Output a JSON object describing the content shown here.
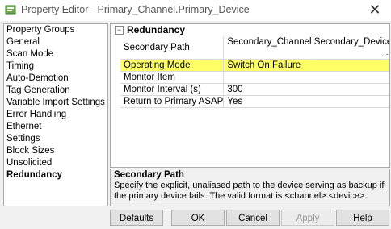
{
  "window": {
    "title": "Property Editor - Primary_Channel.Primary_Device",
    "icons": {
      "app": "properties-icon",
      "close": "close-icon"
    }
  },
  "sidebar": {
    "items": [
      {
        "label": "Property Groups",
        "active": false
      },
      {
        "label": "General",
        "active": false
      },
      {
        "label": "Scan Mode",
        "active": false
      },
      {
        "label": "Timing",
        "active": false
      },
      {
        "label": "Auto-Demotion",
        "active": false
      },
      {
        "label": "Tag Generation",
        "active": false
      },
      {
        "label": "Variable Import Settings",
        "active": false
      },
      {
        "label": "Error Handling",
        "active": false
      },
      {
        "label": "Ethernet",
        "active": false
      },
      {
        "label": "Settings",
        "active": false
      },
      {
        "label": "Block Sizes",
        "active": false
      },
      {
        "label": "Unsolicited",
        "active": false
      },
      {
        "label": "Redundancy",
        "active": true
      }
    ]
  },
  "grid": {
    "section_title": "Redundancy",
    "toggle_symbol": "−",
    "rows": [
      {
        "name": "Secondary Path",
        "value": "Secondary_Channel.Secondary_Device",
        "has_ellipsis": true
      },
      {
        "name": "Operating Mode",
        "value": "Switch On Failure",
        "selected": true
      },
      {
        "name": "Monitor Item",
        "value": ""
      },
      {
        "name": "Monitor Interval (s)",
        "value": "300"
      },
      {
        "name": "Return to Primary ASAP",
        "value": "Yes"
      }
    ],
    "ellipsis": "..."
  },
  "help": {
    "title": "Secondary Path",
    "text": "Specify the explicit, unaliased path to the device serving as backup if the primary device fails. The valid format is <channel>.<device>."
  },
  "buttons": {
    "defaults": "Defaults",
    "ok": "OK",
    "cancel": "Cancel",
    "apply": "Apply",
    "help": "Help"
  },
  "colors": {
    "selection": "#ffff66",
    "border": "#aaaaaa"
  }
}
